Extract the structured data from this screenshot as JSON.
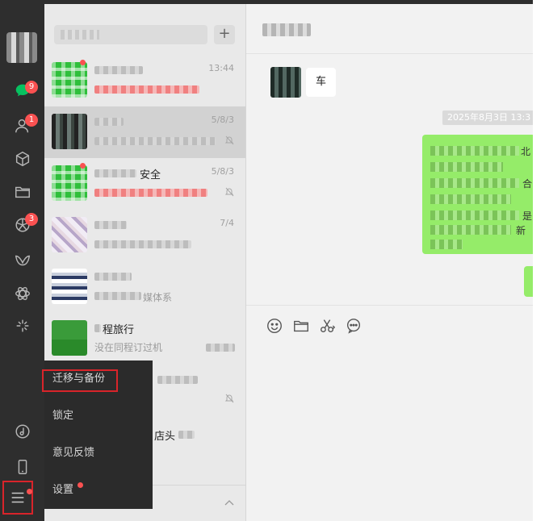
{
  "sidebar": {
    "badges": {
      "chats": "9",
      "contacts": "1",
      "moments": "3"
    },
    "icons": [
      "chat-icon",
      "contacts-icon",
      "cube-icon",
      "folder-icon",
      "moments-icon",
      "channels-icon",
      "mini-programs-icon",
      "search-glint-icon",
      "music-icon",
      "phone-icon",
      "menu-icon"
    ]
  },
  "chat_list": {
    "search_placeholder": "",
    "plus_label": "+",
    "items": [
      {
        "name": "",
        "preview": "",
        "time": "13:44"
      },
      {
        "name": "",
        "preview": "",
        "time": "5/8/3"
      },
      {
        "name": "安全",
        "preview": "",
        "time": "5/8/3"
      },
      {
        "name": "",
        "preview": "",
        "time": "7/4"
      },
      {
        "name": "",
        "preview": "媒体系",
        "time": ""
      },
      {
        "name": "程旅行",
        "preview": "没在同程订过机",
        "time": ""
      },
      {
        "name": "",
        "preview": "",
        "time": ""
      },
      {
        "name": "",
        "preview": "店头",
        "time": ""
      }
    ]
  },
  "popup_menu": {
    "items": [
      {
        "label": "迁移与备份"
      },
      {
        "label": "锁定"
      },
      {
        "label": "意见反馈"
      },
      {
        "label": "设置"
      }
    ]
  },
  "chat_window": {
    "incoming_text": "车",
    "timestamp": "2025年8月3日 13:3",
    "outgoing_fragments": [
      "北",
      "合",
      "是",
      "新"
    ]
  },
  "colors": {
    "sidebar_bg": "#2e2e2e",
    "badge_red": "#fa5151",
    "bubble_green": "#95ec69",
    "highlight_red": "#d9242a"
  }
}
